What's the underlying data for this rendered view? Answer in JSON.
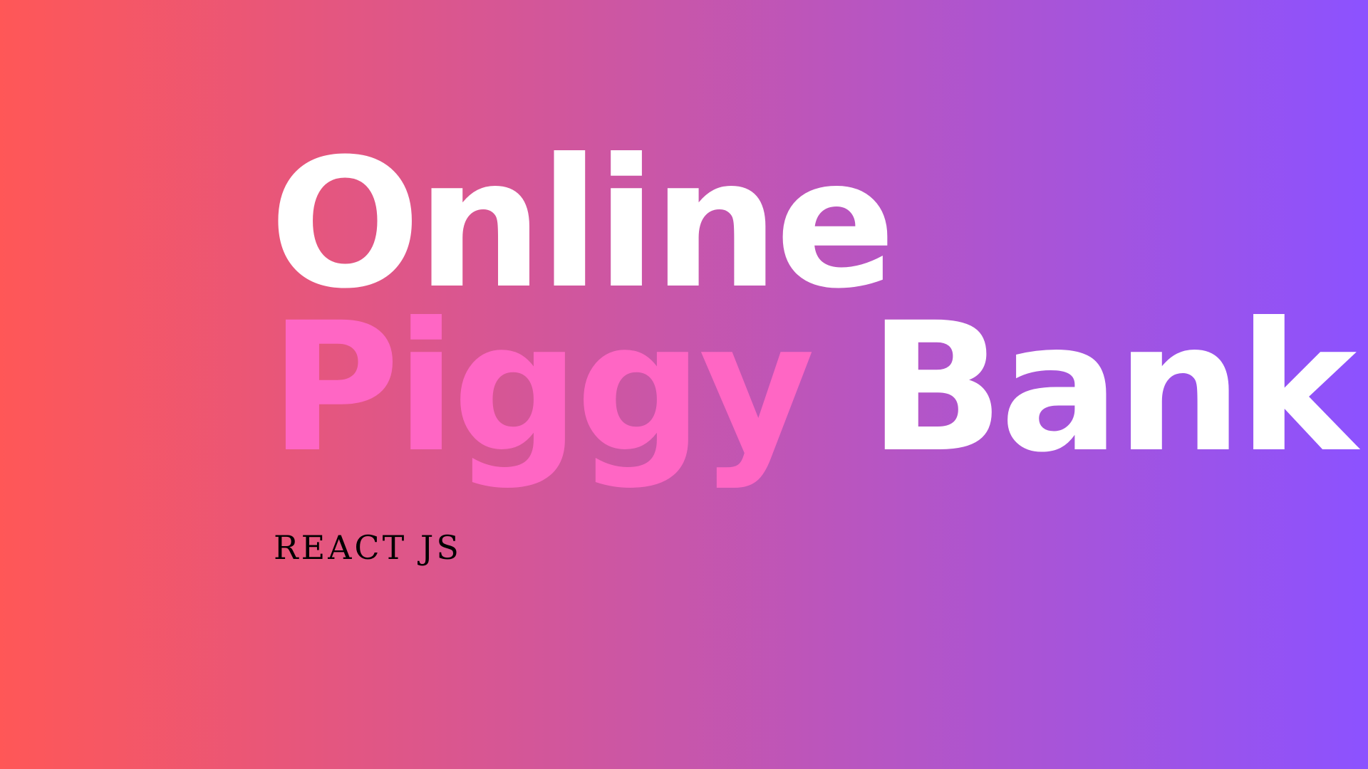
{
  "title": {
    "word1": "Online",
    "word2": "Piggy",
    "word3": "Bank"
  },
  "subtitle": "REACT JS",
  "colors": {
    "gradient_start": "#FF5757",
    "gradient_end": "#8C52FF",
    "accent_pink": "#FF66C4",
    "title_white": "#FFFFFF",
    "subtitle_black": "#000000"
  }
}
